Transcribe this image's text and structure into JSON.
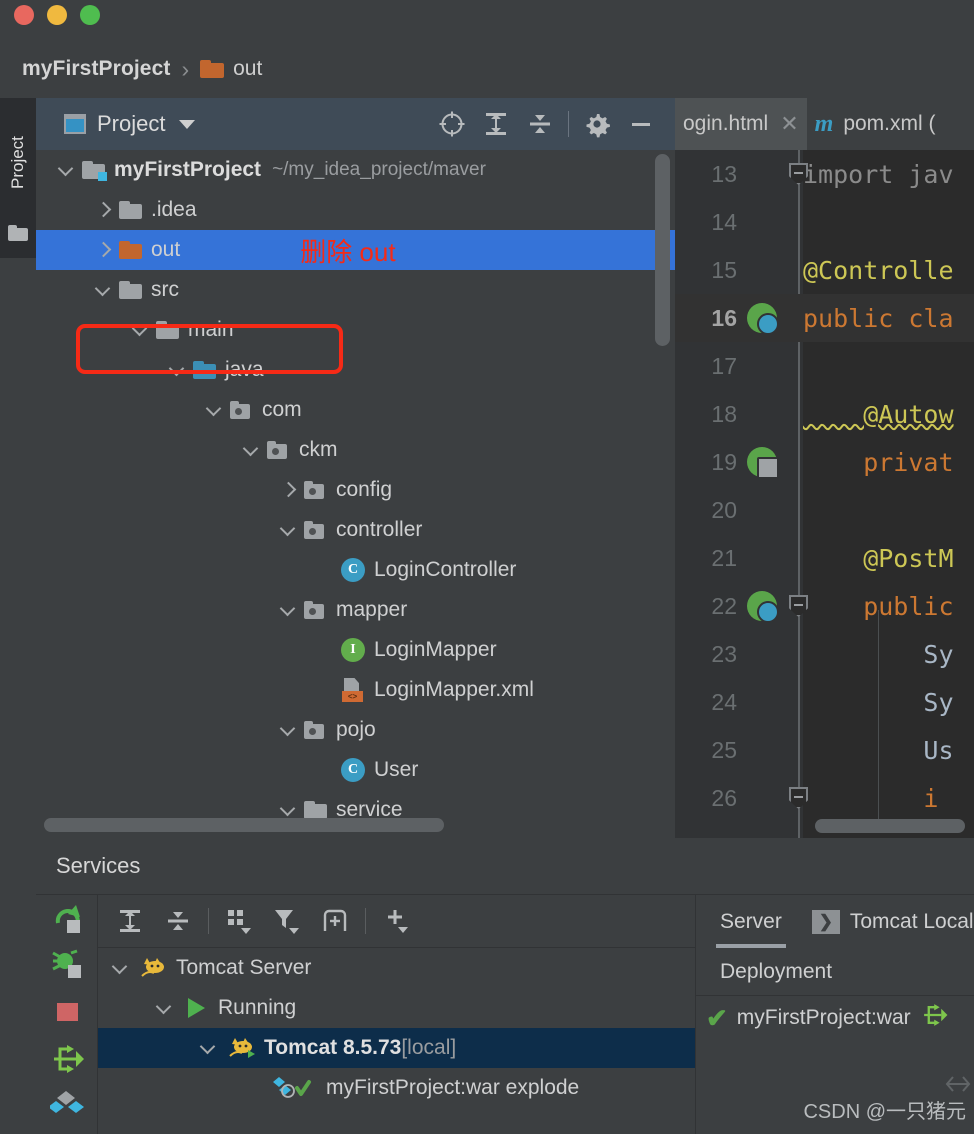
{
  "window": {
    "traffic_lights": [
      "close",
      "minimize",
      "maximize"
    ],
    "colors": {
      "close": "#e8685f",
      "minimize": "#f0b93f",
      "maximize": "#4fbd4f"
    }
  },
  "breadcrumb": {
    "project": "myFirstProject",
    "separator": "›",
    "current": "out",
    "folder_icon": "folder-icon"
  },
  "left_tool_strip": {
    "active_tab": "Project",
    "folder_icon": "folder-icon"
  },
  "project_panel": {
    "title": "Project",
    "dropdown_icon": "chevron-down-icon",
    "toolbar": [
      {
        "name": "select-opened-file-icon",
        "label": "Select Opened File"
      },
      {
        "name": "expand-all-icon",
        "label": "Expand All"
      },
      {
        "name": "collapse-all-icon",
        "label": "Collapse All"
      },
      {
        "name": "settings-gear-icon",
        "label": "Settings"
      },
      {
        "name": "hide-icon",
        "label": "Hide"
      }
    ],
    "annotation": "删除 out",
    "annotation_color": "#f62a16",
    "selection_color": "#3573d8",
    "tree": [
      {
        "label": "myFirstProject",
        "path": "~/my_idea_project/maver",
        "indent": 0,
        "arrow": "down",
        "icon": "module-folder",
        "bold": true
      },
      {
        "label": ".idea",
        "indent": 1,
        "arrow": "right",
        "icon": "folder"
      },
      {
        "label": "out",
        "indent": 1,
        "arrow": "right",
        "icon": "folder-orange",
        "selected": true
      },
      {
        "label": "src",
        "indent": 1,
        "arrow": "down",
        "icon": "folder"
      },
      {
        "label": "main",
        "indent": 2,
        "arrow": "down",
        "icon": "folder"
      },
      {
        "label": "java",
        "indent": 3,
        "arrow": "down",
        "icon": "folder-source"
      },
      {
        "label": "com",
        "indent": 4,
        "arrow": "down",
        "icon": "package"
      },
      {
        "label": "ckm",
        "indent": 5,
        "arrow": "down",
        "icon": "package"
      },
      {
        "label": "config",
        "indent": 6,
        "arrow": "right",
        "icon": "package"
      },
      {
        "label": "controller",
        "indent": 6,
        "arrow": "down",
        "icon": "package"
      },
      {
        "label": "LoginController",
        "indent": 7,
        "arrow": "none",
        "icon": "class"
      },
      {
        "label": "mapper",
        "indent": 6,
        "arrow": "down",
        "icon": "package"
      },
      {
        "label": "LoginMapper",
        "indent": 7,
        "arrow": "none",
        "icon": "interface"
      },
      {
        "label": "LoginMapper.xml",
        "indent": 7,
        "arrow": "none",
        "icon": "xml-file"
      },
      {
        "label": "pojo",
        "indent": 6,
        "arrow": "down",
        "icon": "package"
      },
      {
        "label": "User",
        "indent": 7,
        "arrow": "none",
        "icon": "class"
      },
      {
        "label": "service",
        "indent": 6,
        "arrow": "down",
        "icon": "folder"
      }
    ]
  },
  "editor": {
    "tabs": [
      {
        "label": "ogin.html",
        "icon": "html-file-icon",
        "active": true,
        "closable": true,
        "close_glyph": "✕"
      },
      {
        "label": "pom.xml (",
        "icon": "maven-icon",
        "icon_glyph": "m",
        "active": false
      }
    ],
    "lines": [
      {
        "num": "13",
        "text": "import jav",
        "style": "dim",
        "fold": true
      },
      {
        "num": "14",
        "text": ""
      },
      {
        "num": "15",
        "text": "@Controlle",
        "style": "annotation"
      },
      {
        "num": "16",
        "text": "public cla",
        "style": "keyword",
        "gutter_icon": "spring-bean-icon",
        "highlight": true
      },
      {
        "num": "17",
        "text": ""
      },
      {
        "num": "18",
        "text": "    @Autow",
        "style": "annotation",
        "wavy": true
      },
      {
        "num": "19",
        "text": "    privat",
        "style": "keyword",
        "gutter_icon": "spring-autowired-icon"
      },
      {
        "num": "20",
        "text": ""
      },
      {
        "num": "21",
        "text": "    @PostM",
        "style": "annotation"
      },
      {
        "num": "22",
        "text": "    public",
        "style": "keyword",
        "gutter_icon": "spring-mapping-icon",
        "fold": true
      },
      {
        "num": "23",
        "text": "        Sy",
        "style": "plain"
      },
      {
        "num": "24",
        "text": "        Sy",
        "style": "plain"
      },
      {
        "num": "25",
        "text": "        Us",
        "style": "plain"
      },
      {
        "num": "26",
        "text": "        i",
        "style": "keyword",
        "fold": true
      }
    ]
  },
  "services": {
    "title": "Services",
    "rail_buttons": [
      {
        "name": "rerun-icon",
        "color": "#5aa54a"
      },
      {
        "name": "debug-icon",
        "color": "#5aa54a"
      },
      {
        "name": "stop-icon",
        "color": "#cf6565"
      },
      {
        "name": "redeploy-icon",
        "color": "#7ec64c"
      },
      {
        "name": "deploy-icon",
        "color": "#3b9dc4"
      }
    ],
    "toolbar": [
      {
        "name": "expand-all-icon",
        "label": "Expand All"
      },
      {
        "name": "collapse-all-icon",
        "label": "Collapse All"
      },
      {
        "name": "group-by-icon",
        "label": "Group By",
        "dropdown": true
      },
      {
        "name": "filter-icon",
        "label": "Filter",
        "dropdown": true
      },
      {
        "name": "add-tab-icon",
        "label": "Add Tab"
      },
      {
        "name": "add-icon",
        "label": "Add",
        "dropdown": true
      }
    ],
    "tree": [
      {
        "label": "Tomcat Server",
        "indent": 0,
        "arrow": "down",
        "icon": "tomcat-icon"
      },
      {
        "label": "Running",
        "indent": 1,
        "arrow": "down",
        "icon": "play-icon"
      },
      {
        "label": "Tomcat 8.5.73",
        "suffix": " [local]",
        "indent": 2,
        "arrow": "down",
        "icon": "tomcat-running-icon",
        "selected": true,
        "bold": true
      },
      {
        "label": "myFirstProject:war explode",
        "indent": 3,
        "arrow": "none",
        "icon": "artifact-deployed-icon"
      }
    ],
    "selection_color": "#0d2d4a",
    "right": {
      "tabs": [
        {
          "label": "Server",
          "active": true
        },
        {
          "label": "Tomcat Local",
          "active": false,
          "icon": "run-config-icon",
          "icon_glyph": "❯"
        }
      ],
      "subheader": "Deployment",
      "item": {
        "label": "myFirstProject:war",
        "icon": "check-icon",
        "icon_color": "#5aa54a"
      },
      "action_icon": "redeploy-icon"
    }
  },
  "watermark": "CSDN @一只猪元"
}
